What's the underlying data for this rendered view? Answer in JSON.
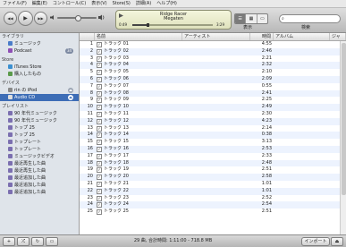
{
  "menu": [
    "ファイル(F)",
    "編集(E)",
    "コントロール(C)",
    "表示(V)",
    "Store(S)",
    "詳細(A)",
    "ヘルプ(H)"
  ],
  "toolbar": {
    "prev": "◀◀",
    "play": "▶",
    "next": "▶▶",
    "now_playing_title": "Ridge Racer",
    "now_playing_album": "Megaten",
    "elapsed": "0:49",
    "remaining": "3:29",
    "view_label": "表示",
    "search_label": "検索",
    "search_placeholder": "",
    "view_mode_selected": 0
  },
  "sidebar": {
    "sections": [
      {
        "title": "ライブラリ",
        "items": [
          {
            "label": "ミュージック",
            "icon": "music-note-icon",
            "color": "#4a7cc9"
          },
          {
            "label": "Podcast",
            "icon": "podcast-icon",
            "color": "#8e4fb5",
            "badge": "34"
          }
        ]
      },
      {
        "title": "Store",
        "items": [
          {
            "label": "iTunes Store",
            "icon": "store-icon",
            "color": "#3b8fd0"
          },
          {
            "label": "購入したもの",
            "icon": "purchased-icon",
            "color": "#5a9a4b"
          }
        ]
      },
      {
        "title": "デバイス",
        "items": [
          {
            "label": "rin の iPod",
            "icon": "ipod-icon",
            "color": "#888888",
            "eject": true
          },
          {
            "label": "Audio CD",
            "icon": "cd-icon",
            "color": "#dddddd",
            "eject": true,
            "selected": true
          }
        ]
      },
      {
        "title": "プレイリスト",
        "items": [
          {
            "label": "90 年代ミュージック",
            "icon": "smart-playlist-icon",
            "color": "#7b6fb0"
          },
          {
            "label": "90 年代ミュージック",
            "icon": "smart-playlist-icon",
            "color": "#7b6fb0"
          },
          {
            "label": "トップ 25",
            "icon": "smart-playlist-icon",
            "color": "#7b6fb0"
          },
          {
            "label": "トップ 25",
            "icon": "smart-playlist-icon",
            "color": "#7b6fb0"
          },
          {
            "label": "トップレート",
            "icon": "smart-playlist-icon",
            "color": "#7b6fb0"
          },
          {
            "label": "トップレート",
            "icon": "smart-playlist-icon",
            "color": "#7b6fb0"
          },
          {
            "label": "ミュージックビデオ",
            "icon": "smart-playlist-icon",
            "color": "#7b6fb0"
          },
          {
            "label": "最近再生した曲",
            "icon": "smart-playlist-icon",
            "color": "#7b6fb0"
          },
          {
            "label": "最近再生した曲",
            "icon": "smart-playlist-icon",
            "color": "#7b6fb0"
          },
          {
            "label": "最近追加した曲",
            "icon": "smart-playlist-icon",
            "color": "#7b6fb0"
          },
          {
            "label": "最近追加した曲",
            "icon": "smart-playlist-icon",
            "color": "#7b6fb0"
          },
          {
            "label": "最近追加した曲",
            "icon": "smart-playlist-icon",
            "color": "#7b6fb0"
          }
        ]
      }
    ]
  },
  "table": {
    "headers": [
      "",
      "名前",
      "アーティスト",
      "時間",
      "アルバム",
      "ジャ"
    ],
    "rows": [
      [
        "1",
        "トラック 01",
        "",
        "4:55",
        ""
      ],
      [
        "2",
        "トラック 02",
        "",
        "2:46",
        ""
      ],
      [
        "3",
        "トラック 03",
        "",
        "2:21",
        ""
      ],
      [
        "4",
        "トラック 04",
        "",
        "2:32",
        ""
      ],
      [
        "5",
        "トラック 05",
        "",
        "2:10",
        ""
      ],
      [
        "6",
        "トラック 06",
        "",
        "2:09",
        ""
      ],
      [
        "7",
        "トラック 07",
        "",
        "0:55",
        ""
      ],
      [
        "8",
        "トラック 08",
        "",
        "2:41",
        ""
      ],
      [
        "9",
        "トラック 09",
        "",
        "2:25",
        ""
      ],
      [
        "10",
        "トラック 10",
        "",
        "2:49",
        ""
      ],
      [
        "11",
        "トラック 11",
        "",
        "2:30",
        ""
      ],
      [
        "12",
        "トラック 12",
        "",
        "4:23",
        ""
      ],
      [
        "13",
        "トラック 13",
        "",
        "2:14",
        ""
      ],
      [
        "14",
        "トラック 14",
        "",
        "0:38",
        ""
      ],
      [
        "15",
        "トラック 15",
        "",
        "3:13",
        ""
      ],
      [
        "16",
        "トラック 16",
        "",
        "2:53",
        ""
      ],
      [
        "17",
        "トラック 17",
        "",
        "2:33",
        ""
      ],
      [
        "18",
        "トラック 18",
        "",
        "2:48",
        ""
      ],
      [
        "19",
        "トラック 19",
        "",
        "2:51",
        ""
      ],
      [
        "20",
        "トラック 20",
        "",
        "2:58",
        ""
      ],
      [
        "21",
        "トラック 21",
        "",
        "1:01",
        ""
      ],
      [
        "22",
        "トラック 22",
        "",
        "1:01",
        ""
      ],
      [
        "23",
        "トラック 23",
        "",
        "2:52",
        ""
      ],
      [
        "24",
        "トラック 24",
        "",
        "2:54",
        ""
      ],
      [
        "25",
        "トラック 25",
        "",
        "2:51",
        ""
      ]
    ]
  },
  "status": {
    "summary": "29 曲, 合計時間: 1:11:00 - 718.8 MB",
    "import_label": "インポート",
    "add_button": "+",
    "shuffle_button": "⤮",
    "repeat_button": "↻",
    "artwork_button": "▭"
  },
  "colors": {
    "selection": "#3d6db6",
    "sidebar_bg": "#dfe4ea",
    "row_stripe": "#edf3fe"
  }
}
